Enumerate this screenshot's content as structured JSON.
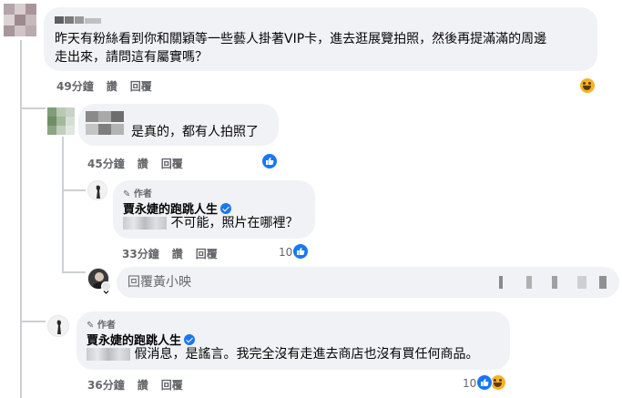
{
  "comments": [
    {
      "text": "昨天有粉絲看到你和關穎等一些藝人掛著VIP卡，進去逛展覽拍照，然後再提滿滿的周邊走出來，請問這有屬實嗎？",
      "line1": "昨天有粉絲看到你和關穎等一些藝人掛著VIP卡，進去逛展覽拍照，然後再提滿滿的周邊",
      "line2": "走出來，請問這有屬實嗎？",
      "time": "49分鐘",
      "like": "讚",
      "reply": "回覆",
      "reaction": "haha"
    },
    {
      "text": "是真的，都有人拍照了",
      "time": "45分鐘",
      "like": "讚",
      "reply": "回覆",
      "reaction": "like"
    },
    {
      "author_tag": "作者",
      "name": "賈永婕的跑跳人生",
      "text": "不可能，照片在哪裡？",
      "time": "33分鐘",
      "like": "讚",
      "reply": "回覆",
      "reaction_count": "10",
      "reaction": "like"
    },
    {
      "author_tag": "作者",
      "name": "賈永婕的跑跳人生",
      "text": "假消息，是謠言。我完全沒有走進去商店也沒有買任何商品。",
      "time": "36分鐘",
      "like": "讚",
      "reply": "回覆",
      "reaction_count": "10",
      "reaction": "like+haha"
    }
  ],
  "reply_box": {
    "placeholder": "回覆黃小映"
  },
  "colors": {
    "bubble": "#f0f2f5",
    "meta": "#65676b",
    "accent": "#1877f2"
  }
}
